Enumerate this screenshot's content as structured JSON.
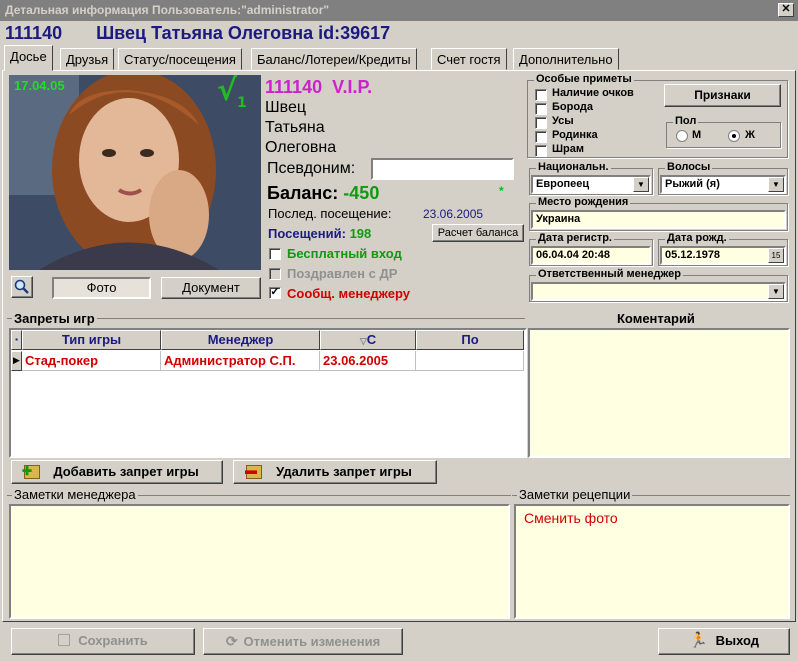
{
  "window": {
    "title": "Детальная информация Пользователь:\"administrator\"",
    "close": "✕"
  },
  "header": {
    "id": "111140",
    "fullname": "Швец Татьяна Олеговна id:39617"
  },
  "tabs": [
    "Досье",
    "Друзья",
    "Статус/посещения",
    "Баланс/Лотереи/Кредиты",
    "Счет гостя",
    "Дополнительно"
  ],
  "photo": {
    "date": "17.04.05",
    "check": "√",
    "check_sub": "1"
  },
  "photo_buttons": {
    "photo": "Фото",
    "document": "Документ"
  },
  "profile": {
    "card": "111140",
    "status": "V.I.P.",
    "last_name": "Швец",
    "first_name": "Татьяна",
    "patronymic": "Олеговна",
    "alias_label": "Псевдоним:",
    "alias_value": "",
    "balance_label": "Баланс:",
    "balance_value": "-450",
    "balance_star": "*",
    "last_visit_label": "Послед. посещение:",
    "last_visit_value": "23.06.2005",
    "visits_label": "Посещений:",
    "visits_value": "198",
    "calc_button": "Расчет баланса",
    "free_entry": "Бесплатный вход",
    "birthday_greeted": "Поздравлен с ДР",
    "notify_manager": "Сообщ. менеджеру"
  },
  "features": {
    "title": "Особые приметы",
    "items": [
      "Наличие очков",
      "Борода",
      "Усы",
      "Родинка",
      "Шрам"
    ],
    "button": "Признаки"
  },
  "gender": {
    "title": "Пол",
    "male": "М",
    "female": "Ж",
    "selected": "Ж"
  },
  "nationality": {
    "label": "Национальн.",
    "value": "Европеец"
  },
  "hair": {
    "label": "Волосы",
    "value": "Рыжий (я)"
  },
  "birthplace": {
    "label": "Место рождения",
    "value": "Украина"
  },
  "reg_date": {
    "label": "Дата регистр.",
    "value": "06.04.04 20:48"
  },
  "birth_date": {
    "label": "Дата рожд.",
    "value": "05.12.1978",
    "cal": "15"
  },
  "manager": {
    "label": "Ответственный менеджер",
    "value": ""
  },
  "bans": {
    "title": "Запреты игр",
    "columns": [
      "Тип игры",
      "Менеджер",
      "С",
      "По"
    ],
    "rows": [
      {
        "game": "Стад-покер",
        "manager": "Администратор С.П.",
        "from": "23.06.2005",
        "to": ""
      }
    ],
    "add_button": "Добавить запрет игры",
    "remove_button": "Удалить запрет игры"
  },
  "comment": {
    "title": "Коментарий"
  },
  "notes_manager": {
    "title": "Заметки менеджера",
    "text": ""
  },
  "notes_reception": {
    "title": "Заметки рецепции",
    "text": "Сменить фото"
  },
  "footer": {
    "save": "Сохранить",
    "cancel": "Отменить изменения",
    "exit": "Выход"
  },
  "colors": {
    "title_navy": "#1a1a80",
    "vip_magenta": "#cc22cc",
    "balance_green": "#119911",
    "red": "#d00000",
    "cream": "#ffffe1"
  }
}
